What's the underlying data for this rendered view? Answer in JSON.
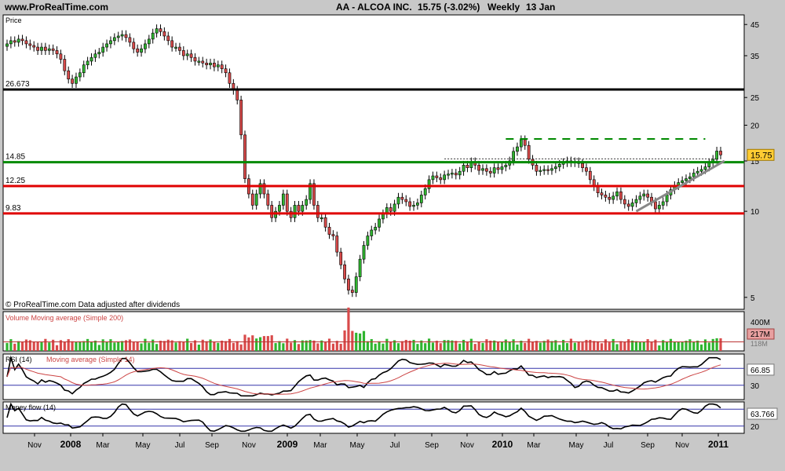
{
  "header": {
    "site": "www.ProRealTime.com",
    "instrument": "AA - ALCOA INC.",
    "quote": "15.75 (-3.02%)",
    "period": "Weekly",
    "date": "13 Jan"
  },
  "colors": {
    "background": "#c8c8c8",
    "panel": "#ffffff",
    "up_candle": "#2fb52f",
    "down_candle": "#d94a4a",
    "level_black": "#000000",
    "level_green": "#008a00",
    "level_red": "#e00000",
    "trendline": "#888888",
    "rsi_ma": "#cc4444",
    "band": "#3333aa"
  },
  "chart_data": [
    {
      "type": "candlestick",
      "panel": "price",
      "title": "Price",
      "scale": "log",
      "ylim": [
        4.6,
        48
      ],
      "y_ticks": [
        5,
        10,
        15,
        20,
        25,
        35,
        45
      ],
      "x_tick_labels": [
        "Nov",
        "2008",
        "Mar",
        "May",
        "Jul",
        "Sep",
        "Nov",
        "2009",
        "Mar",
        "May",
        "Jul",
        "Sep",
        "Nov",
        "2010",
        "Mar",
        "May",
        "Jul",
        "Sep",
        "Nov",
        "2011"
      ],
      "weekly_close": [
        38.5,
        39.5,
        39,
        40,
        39.5,
        38.5,
        38,
        37.5,
        36.5,
        37.5,
        36.5,
        37,
        36.5,
        35.5,
        34,
        31,
        29,
        28,
        29.5,
        30.5,
        32.5,
        33.5,
        34.5,
        35.5,
        36,
        37.5,
        38.5,
        39.5,
        40.5,
        41,
        41.5,
        40.5,
        39,
        37,
        36,
        37,
        38.5,
        40,
        42,
        43.5,
        42.5,
        41,
        39.5,
        37.5,
        37.5,
        36.5,
        35,
        35.5,
        34.5,
        33.5,
        33.5,
        33,
        32.5,
        33,
        32,
        32.5,
        31.5,
        30.5,
        28,
        26.5,
        24.5,
        18.5,
        13,
        11.5,
        10.5,
        11.5,
        12.5,
        11.5,
        10.5,
        9.5,
        10,
        10.5,
        11.5,
        10,
        9.5,
        10.5,
        10,
        10.5,
        11,
        12.5,
        10.5,
        9.5,
        9.5,
        8.8,
        8.3,
        8.2,
        7.2,
        6.5,
        5.8,
        5.3,
        5.2,
        5.9,
        6.8,
        7.6,
        8.2,
        8.6,
        8.8,
        9.4,
        9.8,
        10.3,
        10,
        10.6,
        11.2,
        11,
        10.8,
        10.4,
        10.5,
        10.7,
        11.4,
        12,
        12.9,
        13.3,
        13.1,
        12.9,
        13.4,
        13.5,
        13.6,
        13.4,
        13.8,
        14.5,
        14.2,
        14.9,
        14.5,
        13.9,
        14.1,
        13.8,
        13.6,
        14.2,
        14,
        14.3,
        14.5,
        15,
        16.2,
        16.8,
        17.8,
        17,
        15.2,
        14.5,
        13.8,
        13.9,
        14,
        13.9,
        14.1,
        14.3,
        14.6,
        14.8,
        15,
        14.8,
        14.9,
        14.7,
        14.2,
        13.8,
        12.9,
        12.2,
        11.6,
        11.4,
        11.2,
        11,
        11.3,
        11.7,
        11,
        10.6,
        10.4,
        10.7,
        11,
        11.3,
        11.5,
        11.2,
        10.8,
        10.2,
        10.5,
        10.8,
        11.4,
        11.9,
        12.3,
        12.6,
        12.8,
        13,
        13.2,
        13.6,
        13.8,
        14,
        14.3,
        14.8,
        15.2,
        16.24,
        15.75
      ],
      "levels": [
        {
          "label": "26.673",
          "value": 26.673,
          "color": "black"
        },
        {
          "label": "14.85",
          "value": 14.85,
          "color": "green"
        },
        {
          "label": "12.25",
          "value": 12.25,
          "color": "red"
        },
        {
          "label": "9.83",
          "value": 9.83,
          "color": "red"
        }
      ],
      "last_value_label": "15.75",
      "footer_text": "© ProRealTime.com  Data adjusted after dividends"
    },
    {
      "type": "bar",
      "panel": "volume",
      "title": "Volume Moving average (Simple 200)",
      "y_tick_labels": [
        "400M",
        "217M",
        "118M"
      ],
      "value_label": "217M"
    },
    {
      "type": "line",
      "panel": "rsi",
      "title": "RSI (14)",
      "subtitle": "Moving average (Simple 14)",
      "bands": [
        70,
        30
      ],
      "value_labels": [
        "66.85",
        "30"
      ]
    },
    {
      "type": "line",
      "panel": "mfi",
      "title": "Money flow (14)",
      "bands": [
        80,
        20
      ],
      "value_labels": [
        "63.766",
        "20"
      ]
    }
  ]
}
